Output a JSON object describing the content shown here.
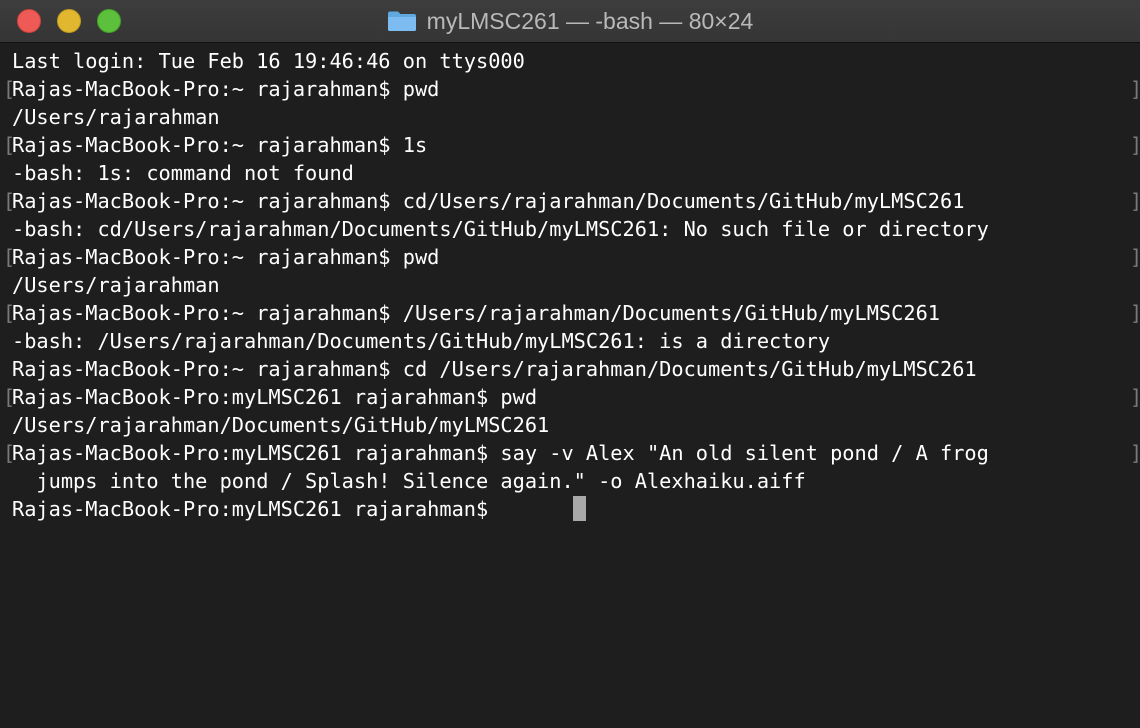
{
  "window": {
    "title": "myLMSC261 — -bash — 80×24",
    "folder_icon": "folder-icon"
  },
  "colors": {
    "close": "#ee5a55",
    "minimize": "#e0b72f",
    "zoom": "#5cc03c",
    "background": "#1e1e1e",
    "text": "#ffffff",
    "cursor": "#a9a9a9"
  },
  "terminal": {
    "lines": [
      "Last login: Tue Feb 16 19:46:46 on ttys000",
      "Rajas-MacBook-Pro:~ rajarahman$ pwd",
      "/Users/rajarahman",
      "Rajas-MacBook-Pro:~ rajarahman$ 1s",
      "-bash: 1s: command not found",
      "Rajas-MacBook-Pro:~ rajarahman$ cd/Users/rajarahman/Documents/GitHub/myLMSC261",
      "-bash: cd/Users/rajarahman/Documents/GitHub/myLMSC261: No such file or directory",
      "Rajas-MacBook-Pro:~ rajarahman$ pwd",
      "/Users/rajarahman",
      "Rajas-MacBook-Pro:~ rajarahman$ /Users/rajarahman/Documents/GitHub/myLMSC261",
      "-bash: /Users/rajarahman/Documents/GitHub/myLMSC261: is a directory",
      "Rajas-MacBook-Pro:~ rajarahman$ cd /Users/rajarahman/Documents/GitHub/myLMSC261",
      "Rajas-MacBook-Pro:myLMSC261 rajarahman$ pwd",
      "/Users/rajarahman/Documents/GitHub/myLMSC261",
      "Rajas-MacBook-Pro:myLMSC261 rajarahman$ say -v Alex \"An old silent pond / A frog",
      "  jumps into the pond / Splash! Silence again.\" -o Alexhaiku.aiff",
      "Rajas-MacBook-Pro:myLMSC261 rajarahman$ "
    ]
  }
}
